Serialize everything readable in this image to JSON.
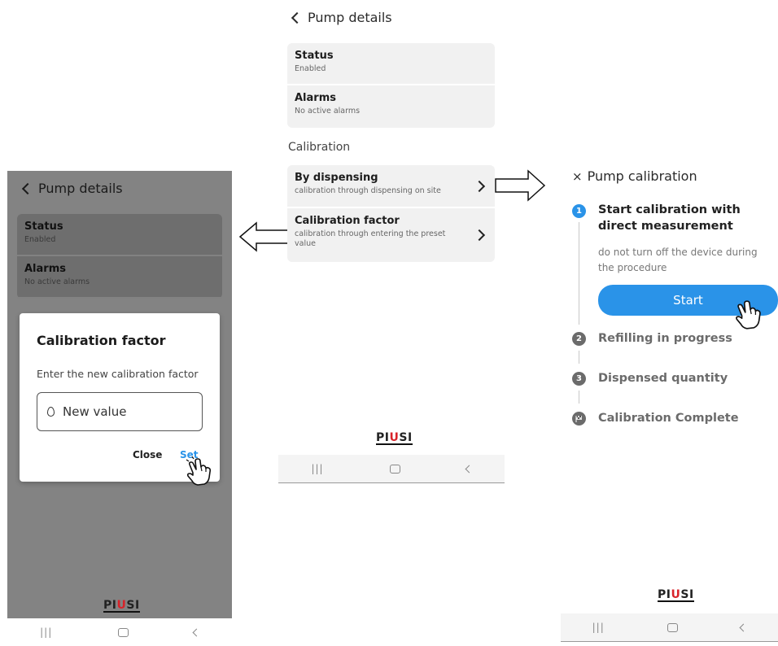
{
  "left_screen": {
    "back_label": "Pump details",
    "rows": [
      {
        "title": "Status",
        "subtitle": "Enabled"
      },
      {
        "title": "Alarms",
        "subtitle": "No active alarms"
      }
    ],
    "dialog": {
      "title": "Calibration factor",
      "message": "Enter the new calibration factor",
      "input_placeholder": "New value",
      "close_label": "Close",
      "set_label": "Set",
      "set_color": "#2a93e8"
    },
    "logo": {
      "pre": "PI",
      "u": "U",
      "post": "SI"
    }
  },
  "center_screen": {
    "back_label": "Pump details",
    "rows": [
      {
        "title": "Status",
        "subtitle": "Enabled"
      },
      {
        "title": "Alarms",
        "subtitle": "No active alarms"
      }
    ],
    "section_label": "Calibration",
    "calibration_rows": [
      {
        "title": "By dispensing",
        "subtitle": "calibration through dispensing on site"
      },
      {
        "title": "Calibration factor",
        "subtitle": "calibration through entering the preset value"
      }
    ],
    "logo": {
      "pre": "PI",
      "u": "U",
      "post": "SI"
    }
  },
  "right_screen": {
    "close_label": "Pump calibration",
    "steps": [
      {
        "number": "1",
        "title": "Start calibration with direct measurement",
        "subtitle": "do not turn off the device during the procedure",
        "active": true
      },
      {
        "number": "2",
        "title": "Refilling in progress",
        "active": false
      },
      {
        "number": "3",
        "title": "Dispensed quantity",
        "active": false
      },
      {
        "number": "",
        "title": "Calibration Complete",
        "active": false,
        "icon": "flag-icon"
      }
    ],
    "start_label": "Start",
    "accent": "#2a93e8",
    "logo": {
      "pre": "PI",
      "u": "U",
      "post": "SI"
    }
  }
}
